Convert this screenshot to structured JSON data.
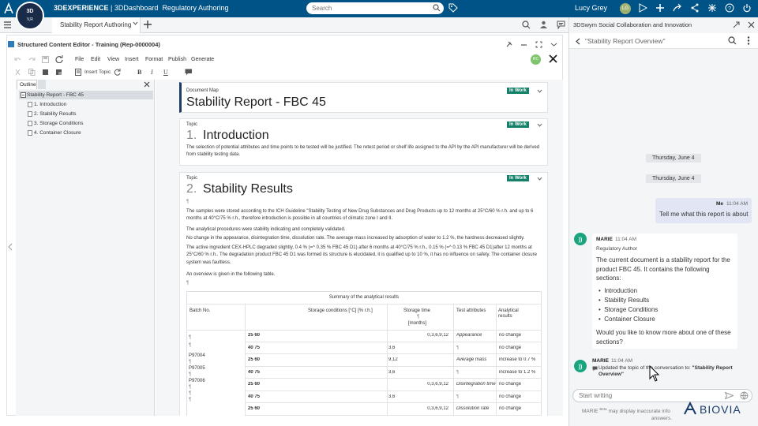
{
  "app": {
    "brand_prefix": "3DEXPERIENCE",
    "brand_dash": "| 3DDashboard",
    "brand_app": "Regulatory Authoring",
    "search_placeholder": "Search",
    "user_name": "Lucy Grey",
    "user_initials": "LG",
    "compass_version": "V,R"
  },
  "tabbar": {
    "active_tab": "Stability Report Authoring"
  },
  "right_panel": {
    "title": "3DSwym Social Collaboration and Innovation",
    "conversation_title": "\"Stability Report Overview\"",
    "dates": [
      "Thursday, June 4",
      "Thursday, June 4"
    ],
    "me_label": "Me",
    "me_time": "11:04 AM",
    "me_message": "Tell me what this report is about",
    "ai_name": "MARIE",
    "ai_time": "11:04 AM",
    "ai_role": "Regulatory Author",
    "ai_intro": "The current document is a stability report for the product FBC 45. It contains the following sections:",
    "ai_sections": [
      "Introduction",
      "Stability Results",
      "Storage Conditions",
      "Container Closure"
    ],
    "ai_question": "Would you like to know more about one of these sections?",
    "ai2_name": "MARIE",
    "ai2_time": "11:04 AM",
    "ai2_update_prefix": "Updated the topic of the conversation to:",
    "ai2_update_topic": "\"Stability Report Overview\"",
    "input_placeholder": "Start writing",
    "disclaimer_name": "MARIE",
    "disclaimer_beta": "Beta",
    "disclaimer_text": "may display inaccurate info",
    "disclaimer_tail": "answers.",
    "logo_text": "BIOVIA"
  },
  "editor": {
    "title": "Structured Content Editor - Training (Rep-0000004)",
    "menus": [
      "File",
      "Edit",
      "View",
      "Insert",
      "Format",
      "Publish",
      "Generate"
    ],
    "insert_topic": "Insert Topic",
    "status_initials": "RC",
    "outline_tab": "Outline",
    "outline_root": "Stability Report - FBC 45",
    "outline_items": [
      "1. Introduction",
      "2. Stability Results",
      "3. Storage Conditions",
      "4. Container Closure"
    ]
  },
  "document": {
    "map_label": "Document Map",
    "map_title": "Stability Report - FBC 45",
    "status": "In Work",
    "topic_label": "Topic",
    "intro_number": "1.",
    "intro_title": "Introduction",
    "intro_text": "The selection of potential attributes and time points to be tested will be justified. The retest period or shelf life assigned to the API by the API manufacturer will be derived from stability testing data.",
    "results_number": "2.",
    "results_title": "Stability Results",
    "pilcrow": "¶",
    "results_p1": "The samples were stored according to the ICH Guideline \"Stability Testing of New Drug Substances and Drug Products up to 12 months at 25°C/60 % r.h. and up to 6 months at 40°C/75 % r.h., therefore introduction is possible in all countries of climatic zone I and II.",
    "results_p2": "The analytical procedures were stability indicating and completely validated.",
    "results_p3": "No change in the appearance, disintegration time, dissolution rate. The average mass increased by adsorption of water to 1.2 %, the hardness decreased slightly.",
    "results_p4": "The active ingredient CEX-HPLC degraded slightly, 0.4 % (=^ 0.35 % FBC 45 D1) after 6 months at 40°C/75 % r.h., 0.15 % (=^ 0.13 % FBC 45 D1)after 12 months at 25°C/60 % r.h.. The degradation product FBC 45 D1 was formed its structure is elucidated, it is qualified up to 10 %, it has no influence on safety. The container closure system was faultless.",
    "results_p5": "An overview is given in the following table.",
    "table": {
      "caption": "Summary of the analytical results",
      "headers": [
        "Batch No.",
        "Storage conditions [°C] [% r.h.]",
        "Storage time",
        "[months]",
        "Test attributes",
        "Analytical results"
      ],
      "batches": [
        "P97004",
        "P97005",
        "P97006"
      ],
      "rows": [
        {
          "cond": "25 60",
          "time": "0,3,6,9,12",
          "attr": "Appearance",
          "result": "no change"
        },
        {
          "cond": "40 75",
          "time": "3,6",
          "attr": "¶",
          "result": "no change"
        },
        {
          "cond": "25 60",
          "time": "9,12",
          "attr": "Average mass",
          "result": "increase to 0.7 %"
        },
        {
          "cond": "40 75",
          "time": "3,6",
          "attr": "¶",
          "result": "increase to 1.2 %"
        },
        {
          "cond": "25 60",
          "time": "0,3,6,9,12",
          "attr": "Disintegration time",
          "result": "no change"
        },
        {
          "cond": "40 75",
          "time": "3,6",
          "attr": "¶",
          "result": "no change"
        },
        {
          "cond": "25 60",
          "time": "0,3,6,9,12",
          "attr": "Dissolution rate",
          "result": "no change"
        }
      ]
    }
  }
}
